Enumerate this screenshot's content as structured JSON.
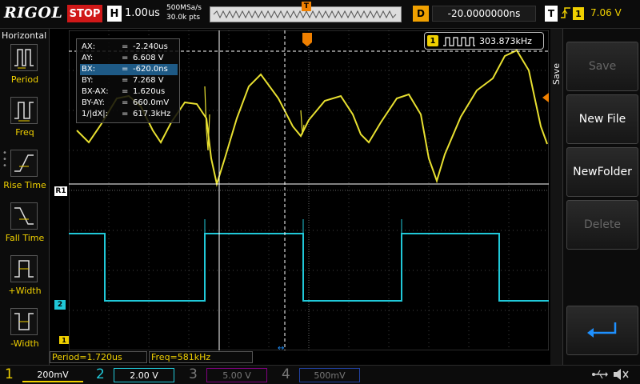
{
  "brand": "RIGOL",
  "acq": {
    "status": "STOP",
    "h_label": "H",
    "h_scale": "1.00us",
    "sample_rate": "500MSa/s",
    "mem_depth": "30.0k pts",
    "trig_pos_marker": "T"
  },
  "delay": {
    "label": "D",
    "value": "-20.0000000ns"
  },
  "trigger": {
    "label": "T",
    "edge_icon": "rising-edge-icon",
    "source": "1",
    "level": "7.06 V",
    "color": "#f0d000"
  },
  "left_menu": {
    "title": "Horizontal",
    "items": [
      {
        "name": "period",
        "label": "Period"
      },
      {
        "name": "freq",
        "label": "Freq"
      },
      {
        "name": "rise-time",
        "label": "Rise Time"
      },
      {
        "name": "fall-time",
        "label": "Fall Time"
      },
      {
        "name": "plus-width",
        "label": "+Width"
      },
      {
        "name": "minus-width",
        "label": "-Width"
      }
    ]
  },
  "cursor_readout": [
    {
      "key": "AX:",
      "value": "-2.240us",
      "selected": false
    },
    {
      "key": "AY:",
      "value": "6.608 V",
      "selected": false
    },
    {
      "key": "BX:",
      "value": "-620.0ns",
      "selected": true
    },
    {
      "key": "BY:",
      "value": "7.268 V",
      "selected": false
    },
    {
      "key": "BX-AX:",
      "value": "1.620us",
      "selected": false
    },
    {
      "key": "BY-AY:",
      "value": "660.0mV",
      "selected": false
    },
    {
      "key": "1/|dX|:",
      "value": "617.3kHz",
      "selected": false
    }
  ],
  "freq_counter": {
    "channel": "1",
    "value": "303.873kHz"
  },
  "markers": {
    "ref_r1": "R1",
    "ch2": "2",
    "ch1": "1"
  },
  "measurements": {
    "period": "Period=1.720us",
    "freq": "Freq=581kHz"
  },
  "right_menu": {
    "tab": "Save",
    "buttons": [
      {
        "name": "save",
        "label": "Save",
        "enabled": false
      },
      {
        "name": "new-file",
        "label": "New File",
        "enabled": true
      },
      {
        "name": "new-folder",
        "label": "NewFolder",
        "enabled": true
      },
      {
        "name": "delete",
        "label": "Delete",
        "enabled": false
      },
      {
        "name": "back",
        "label": "",
        "icon": "return-arrow-icon",
        "enabled": true
      }
    ]
  },
  "channels": [
    {
      "num": "1",
      "scale": "200mV",
      "color": "#f0d000",
      "active": true
    },
    {
      "num": "2",
      "scale": "2.00 V",
      "color": "#00c8d8",
      "active": true
    },
    {
      "num": "3",
      "scale": "5.00 V",
      "color": "#c000c0",
      "active": false
    },
    {
      "num": "4",
      "scale": "500mV",
      "color": "#3060ff",
      "active": false
    }
  ],
  "status_icons": [
    "usb-icon",
    "speaker-muted-icon"
  ],
  "colors": {
    "ch1": "#e8e030",
    "ch2": "#20c8d8",
    "accent_orange": "#f08000",
    "selected_row": "#1e5a86"
  }
}
